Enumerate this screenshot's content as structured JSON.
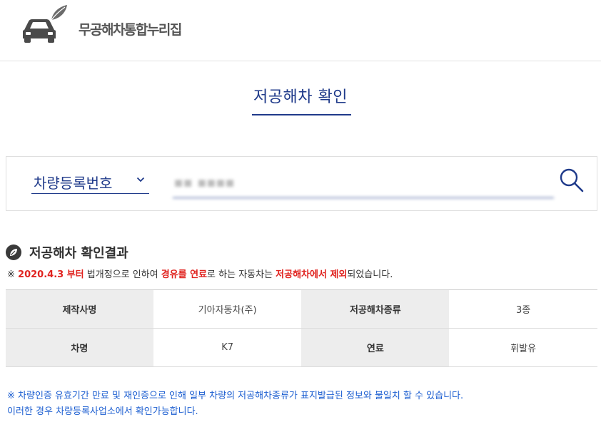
{
  "header": {
    "logo_text": "무공해차통합누리집"
  },
  "page": {
    "title": "저공해차 확인"
  },
  "search": {
    "select_label": "차량등록번호",
    "plate_value": "■■ ■■■■",
    "search_icon": "search-icon"
  },
  "result": {
    "title": "저공해차 확인결과",
    "notice": {
      "prefix": "※ ",
      "date": "2020.4.3 부터",
      "p1": " 법개정으로 인하여 ",
      "fuel": "경유를 연료",
      "p2": "로 하는 자동차는 ",
      "excluded": "저공해차에서 제외",
      "p3": "되었습니다."
    },
    "rows": [
      {
        "label1": "제작사명",
        "value1": "기아자동차(주)",
        "label2": "저공해차종류",
        "value2": "3종"
      },
      {
        "label1": "차명",
        "value1": "K7",
        "label2": "연료",
        "value2": "휘발유"
      }
    ],
    "footer_line1": "※ 차량인증 유효기간 만료 및 재인증으로 인해 일부 차량의 저공해차종류가 표지발급된 정보와 불일치 할 수 있습니다.",
    "footer_line2": "이러한 경우 차량등록사업소에서 확인가능합니다."
  },
  "colors": {
    "accent": "#1f3a8a",
    "warning_red": "#e0231f",
    "info_blue": "#1d5fd1"
  }
}
